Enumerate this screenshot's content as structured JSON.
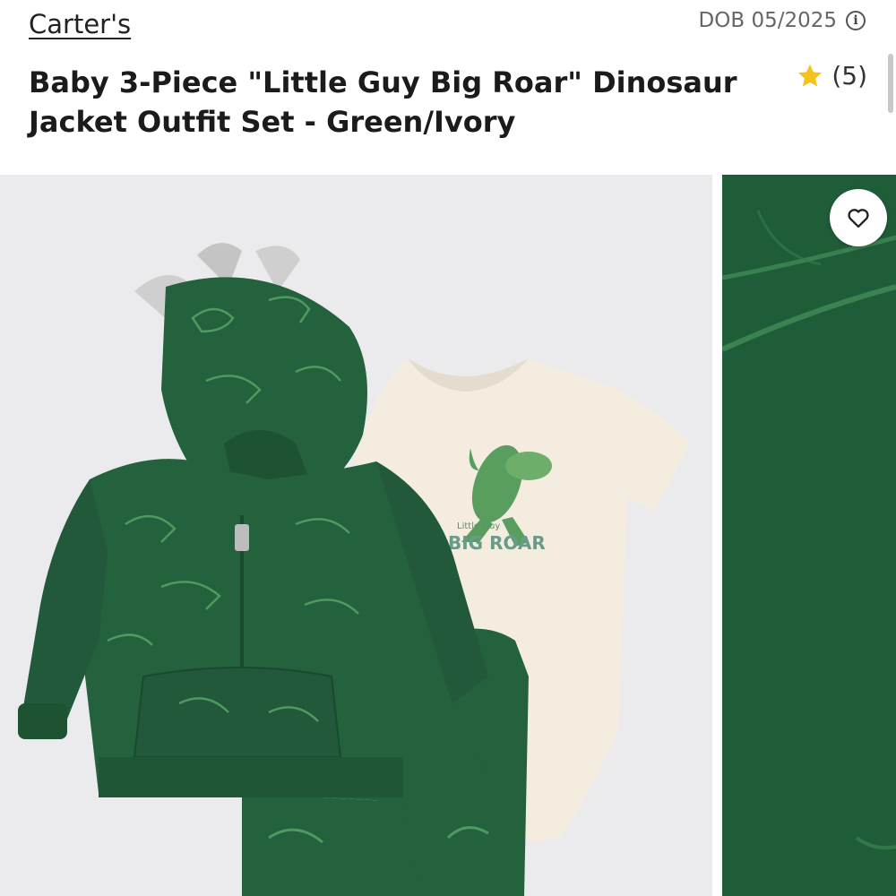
{
  "header": {
    "brand": "Carter's",
    "dob": "DOB 05/2025",
    "title": "Baby 3-Piece \"Little Guy Big Roar\" Dinosaur Jacket Outfit Set - Green/Ivory",
    "rating_count": "(5)"
  },
  "gallery": {
    "bodysuit_print_small": "Little        Guy",
    "bodysuit_print_big": "BIG ROAR"
  },
  "colors": {
    "jacket_green": "#24613d",
    "print_green": "#4f9a5e",
    "ivory": "#f3ecdf",
    "star": "#f4c21c",
    "background": "#ebebed"
  },
  "icons": [
    "info-icon",
    "star-icon",
    "heart-icon"
  ]
}
